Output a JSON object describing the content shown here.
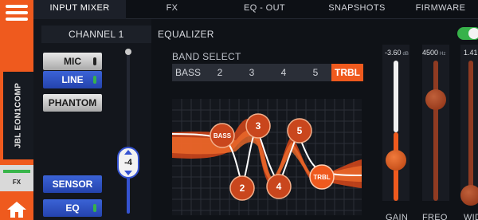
{
  "nav": {
    "tabs": [
      {
        "label": "INPUT MIXER",
        "active": true
      },
      {
        "label": "FX",
        "active": false
      },
      {
        "label": "EQ - OUT",
        "active": false
      },
      {
        "label": "SNAPSHOTS",
        "active": false
      },
      {
        "label": "FIRMWARE",
        "active": false
      }
    ]
  },
  "sidebar": {
    "device_label": "JBL EON1COMP",
    "fx_label": "FX",
    "menu_icon": "hamburger-icon",
    "home_icon": "home-icon"
  },
  "channel": {
    "title": "CHANNEL 1",
    "mic_label": "MIC",
    "line_label": "LINE",
    "phantom_label": "PHANTOM",
    "sensor_label": "SENSOR",
    "eq_label": "EQ",
    "fader_value": "-4"
  },
  "equalizer": {
    "title": "EQUALIZER",
    "enabled": true,
    "band_select_label": "BAND SELECT",
    "bands": [
      "BASS",
      "2",
      "3",
      "4",
      "5",
      "TRBL"
    ],
    "active_band": "TRBL",
    "nodes": [
      "BASS",
      "2",
      "3",
      "4",
      "5",
      "TRBL"
    ]
  },
  "faders": {
    "gain": {
      "value": "-3.60",
      "unit": "dB",
      "label": "GAIN"
    },
    "freq": {
      "value": "4500",
      "unit": "Hz",
      "label": "FREQ"
    },
    "width": {
      "value": "1.41",
      "label": "WID"
    }
  },
  "colors": {
    "accent": "#ef5a1e",
    "blue": "#3553d1",
    "active_green": "#37b24a"
  }
}
